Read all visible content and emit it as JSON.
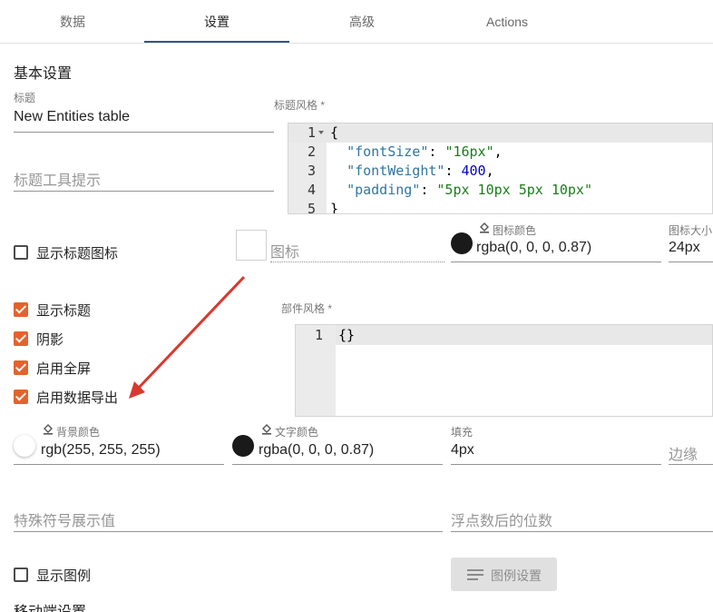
{
  "tabs": [
    {
      "label": "数据",
      "active": false
    },
    {
      "label": "设置",
      "active": true
    },
    {
      "label": "高级",
      "active": false
    },
    {
      "label": "Actions",
      "active": false
    }
  ],
  "basic_settings": {
    "section_title": "基本设置",
    "title_label": "标题",
    "title_value": "New Entities table",
    "tooltip_placeholder": "标题工具提示",
    "title_style_label": "标题风格 *",
    "title_style_code": {
      "line_numbers": [
        "1",
        "2",
        "3",
        "4",
        "5"
      ],
      "lines": [
        {
          "parts": [
            {
              "t": "p",
              "v": "{"
            }
          ]
        },
        {
          "parts": [
            {
              "t": "p",
              "v": "  "
            },
            {
              "t": "k",
              "v": "\"fontSize\""
            },
            {
              "t": "p",
              "v": ": "
            },
            {
              "t": "s",
              "v": "\"16px\""
            },
            {
              "t": "p",
              "v": ","
            }
          ]
        },
        {
          "parts": [
            {
              "t": "p",
              "v": "  "
            },
            {
              "t": "k",
              "v": "\"fontWeight\""
            },
            {
              "t": "p",
              "v": ": "
            },
            {
              "t": "n",
              "v": "400"
            },
            {
              "t": "p",
              "v": ","
            }
          ]
        },
        {
          "parts": [
            {
              "t": "p",
              "v": "  "
            },
            {
              "t": "k",
              "v": "\"padding\""
            },
            {
              "t": "p",
              "v": ": "
            },
            {
              "t": "s",
              "v": "\"5px 10px 5px 10px\""
            }
          ]
        },
        {
          "parts": [
            {
              "t": "p",
              "v": "}"
            }
          ]
        }
      ]
    },
    "show_title_icon_label": "显示标题图标",
    "show_title_icon_checked": false,
    "icon_placeholder": "图标",
    "icon_color_label": "图标颜色",
    "icon_color_value": "rgba(0, 0, 0, 0.87)",
    "icon_size_label": "图标大小",
    "icon_size_value": "24px",
    "checkboxes": [
      {
        "label": "显示标题",
        "checked": true
      },
      {
        "label": "阴影",
        "checked": true
      },
      {
        "label": "启用全屏",
        "checked": true
      },
      {
        "label": "启用数据导出",
        "checked": true
      }
    ],
    "widget_style_label": "部件风格 *",
    "widget_style_code": {
      "line_numbers": [
        "1"
      ],
      "text": "{}"
    },
    "bg_color_label": "背景颜色",
    "bg_color_value": "rgb(255, 255, 255)",
    "text_color_label": "文字颜色",
    "text_color_value": "rgba(0, 0, 0, 0.87)",
    "padding_label": "填充",
    "padding_value": "4px",
    "margin_placeholder": "边缘",
    "special_symbol_placeholder": "特殊符号展示值",
    "decimals_placeholder": "浮点数后的位数",
    "show_legend_label": "显示图例",
    "show_legend_checked": false,
    "legend_settings_button": "图例设置",
    "mobile_section_title": "移动端设置"
  },
  "colors": {
    "accent_checkbox": "#e5622d",
    "tab_ink": "#305680",
    "annotation_arrow": "#d9382e"
  }
}
